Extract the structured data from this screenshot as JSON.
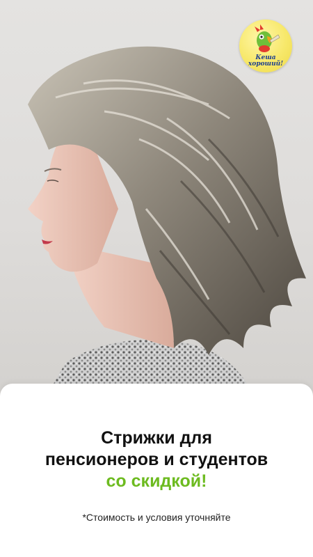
{
  "logo": {
    "line1": "Кеша",
    "line2": "хороший!",
    "colors": {
      "background": "#f7e86a",
      "text": "#1d3f8f"
    }
  },
  "promo": {
    "title_line1": "Стрижки для",
    "title_line2": "пенсионеров и студентов",
    "title_accent": "со скидкой!",
    "accent_color": "#6dbb20"
  },
  "note": "*Стоимость и условия уточняйте",
  "photo": {
    "subject": "woman-profile-layered-gray-haircut"
  }
}
